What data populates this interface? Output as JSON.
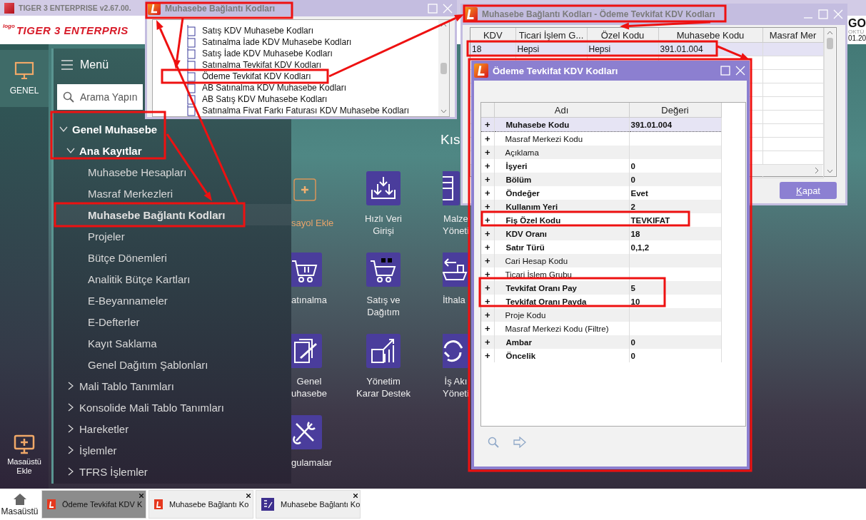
{
  "app_title": "TIGER 3 ENTERPRISE v2.67.00.",
  "header": {
    "logo_small": "logo",
    "logo": "TIGER 3 ENTERPRIS",
    "right_texts": [
      "GO",
      "OKTÜ",
      "01.20"
    ]
  },
  "rail": {
    "items": [
      {
        "label": "GENEL",
        "selected": true
      }
    ],
    "add_button": "Masaüstü Ekle"
  },
  "menu": {
    "title": "Menü",
    "search_placeholder": "Arama Yapın",
    "tree": [
      {
        "label": "Genel Muhasebe",
        "expanded": true,
        "selected": false,
        "children": [
          {
            "label": "Ana Kayıtlar",
            "expanded": true,
            "selected": false,
            "children": [
              {
                "label": "Muhasebe Hesapları",
                "selected": false
              },
              {
                "label": "Masraf Merkezleri",
                "selected": false
              },
              {
                "label": "Muhasebe Bağlantı Kodları",
                "selected": true
              },
              {
                "label": "Projeler",
                "selected": false
              },
              {
                "label": "Bütçe Dönemleri",
                "selected": false
              },
              {
                "label": "Analitik Bütçe Kartları",
                "selected": false
              },
              {
                "label": "E-Beyannameler",
                "selected": false
              },
              {
                "label": "E-Defterler",
                "selected": false
              },
              {
                "label": "Kayıt Saklama",
                "selected": false
              },
              {
                "label": "Genel Dağıtım Şablonları",
                "selected": false
              }
            ]
          },
          {
            "label": "Mali Tablo Tanımları",
            "expanded": false,
            "selected": false
          },
          {
            "label": "Konsolide Mali Tablo Tanımları",
            "expanded": false,
            "selected": false
          },
          {
            "label": "Hareketler",
            "expanded": false,
            "selected": false
          },
          {
            "label": "İşlemler",
            "expanded": false,
            "selected": false
          },
          {
            "label": "TFRS İşlemler",
            "expanded": false,
            "selected": false
          }
        ]
      }
    ]
  },
  "launcher": {
    "title": "Kıs",
    "tiles": [
      {
        "kind": "add",
        "lines": [
          "sayol Ekle"
        ]
      },
      {
        "kind": "import",
        "lines": [
          "Hızlı Veri",
          "Girişi"
        ]
      },
      {
        "kind": "list",
        "lines": [
          "Malze",
          "Yöneti"
        ]
      },
      {
        "kind": "cart",
        "lines": [
          "atınalma"
        ]
      },
      {
        "kind": "cart-boxes",
        "lines": [
          "Satış ve",
          "Dağıtım"
        ]
      },
      {
        "kind": "ship",
        "lines": [
          "İthala"
        ]
      },
      {
        "kind": "document",
        "lines": [
          "Genel",
          "uhasebe"
        ]
      },
      {
        "kind": "report",
        "lines": [
          "Yönetim",
          "Karar Destek"
        ]
      },
      {
        "kind": "cycle",
        "lines": [
          "İş Akı",
          "Yöneti"
        ]
      },
      {
        "kind": "tools",
        "lines": [
          "gulamalar"
        ]
      }
    ]
  },
  "code_list_window": {
    "title": "Muhasebe Bağlantı Kodları",
    "items": [
      "Satış KDV Muhasebe Kodları",
      "Satınalma İade KDV Muhasebe Kodları",
      "Satış İade KDV Muhasebe Kodları",
      "Satınalma Tevkifat KDV Kodları",
      "Ödeme Tevkifat KDV Kodları",
      "AB Satınalma KDV Muhasebe Kodları",
      "AB Satış KDV Muhasebe Kodları",
      "Satınalma Fivat Farkı Faturası KDV Muhasebe Kodları"
    ]
  },
  "codes_window": {
    "title": "Muhasebe Bağlantı Kodları - Ödeme Tevkifat KDV Kodları",
    "columns": [
      "KDV",
      "Ticari İşlem G...",
      "Özel Kodu",
      "Muhasebe Kodu",
      "Masraf Mer"
    ],
    "rows": [
      {
        "cells": [
          "18",
          "Hepsi",
          "Hepsi",
          "391.01.004"
        ],
        "selected": true
      }
    ],
    "button": "Kapat"
  },
  "details_dialog": {
    "title": "Ödeme Tevkifat KDV Kodları",
    "columns": [
      "Adı",
      "Değeri"
    ],
    "rows": [
      {
        "expander": "+",
        "name": "Muhasebe Kodu",
        "value": "391.01.004",
        "bold": true,
        "selected": true
      },
      {
        "expander": "+",
        "name": "Masraf Merkezi Kodu",
        "bold": false,
        "selected": false
      },
      {
        "expander": "+",
        "name": "Açıklama",
        "bold": false,
        "selected": false
      },
      {
        "expander": "+",
        "name": "İşyeri",
        "value": "0",
        "bold": true,
        "selected": false
      },
      {
        "expander": "+",
        "name": "Bölüm",
        "value": "0",
        "bold": true,
        "selected": false
      },
      {
        "expander": "+",
        "name": "Öndeğer",
        "value": "Evet",
        "bold": true,
        "selected": false
      },
      {
        "expander": "+",
        "name": "Kullanım Yeri",
        "value": "2",
        "bold": true,
        "selected": false
      },
      {
        "expander": "+",
        "name": "Fiş Özel Kodu",
        "value": "TEVKIFAT",
        "bold": true,
        "selected": false
      },
      {
        "expander": "+",
        "name": "KDV Oranı",
        "value": "18",
        "bold": true,
        "selected": false
      },
      {
        "expander": "+",
        "name": "Satır Türü",
        "value": "0,1,2",
        "bold": true,
        "selected": false
      },
      {
        "expander": "+",
        "name": "Cari Hesap Kodu",
        "bold": false,
        "selected": false
      },
      {
        "expander": "+",
        "name": "Ticari İşlem Grubu",
        "bold": false,
        "selected": false
      },
      {
        "expander": "+",
        "name": "Tevkifat Oranı Pay",
        "value": "5",
        "bold": true,
        "selected": false
      },
      {
        "expander": "+",
        "name": "Tevkifat Oranı Payda",
        "value": "10",
        "bold": true,
        "selected": false
      },
      {
        "expander": "+",
        "name": "Proje Kodu",
        "bold": false,
        "selected": false
      },
      {
        "expander": "+",
        "name": "Masraf Merkezi Kodu (Filtre)",
        "bold": false,
        "selected": false
      },
      {
        "expander": "+",
        "name": "Ambar",
        "value": "0",
        "bold": true,
        "selected": false
      },
      {
        "expander": "+",
        "name": "Öncelik",
        "value": "0",
        "bold": true,
        "selected": false
      }
    ]
  },
  "taskbar": {
    "home": "Masaüstü",
    "tabs": [
      {
        "label": "Ödeme Tevkifat KDV K",
        "kind": "logo",
        "selected": true
      },
      {
        "label": "Muhasebe Bağlantı Ko",
        "kind": "logo",
        "selected": false
      },
      {
        "label": "Muhasebe Bağlantı Ko",
        "kind": "form",
        "selected": false
      }
    ]
  }
}
